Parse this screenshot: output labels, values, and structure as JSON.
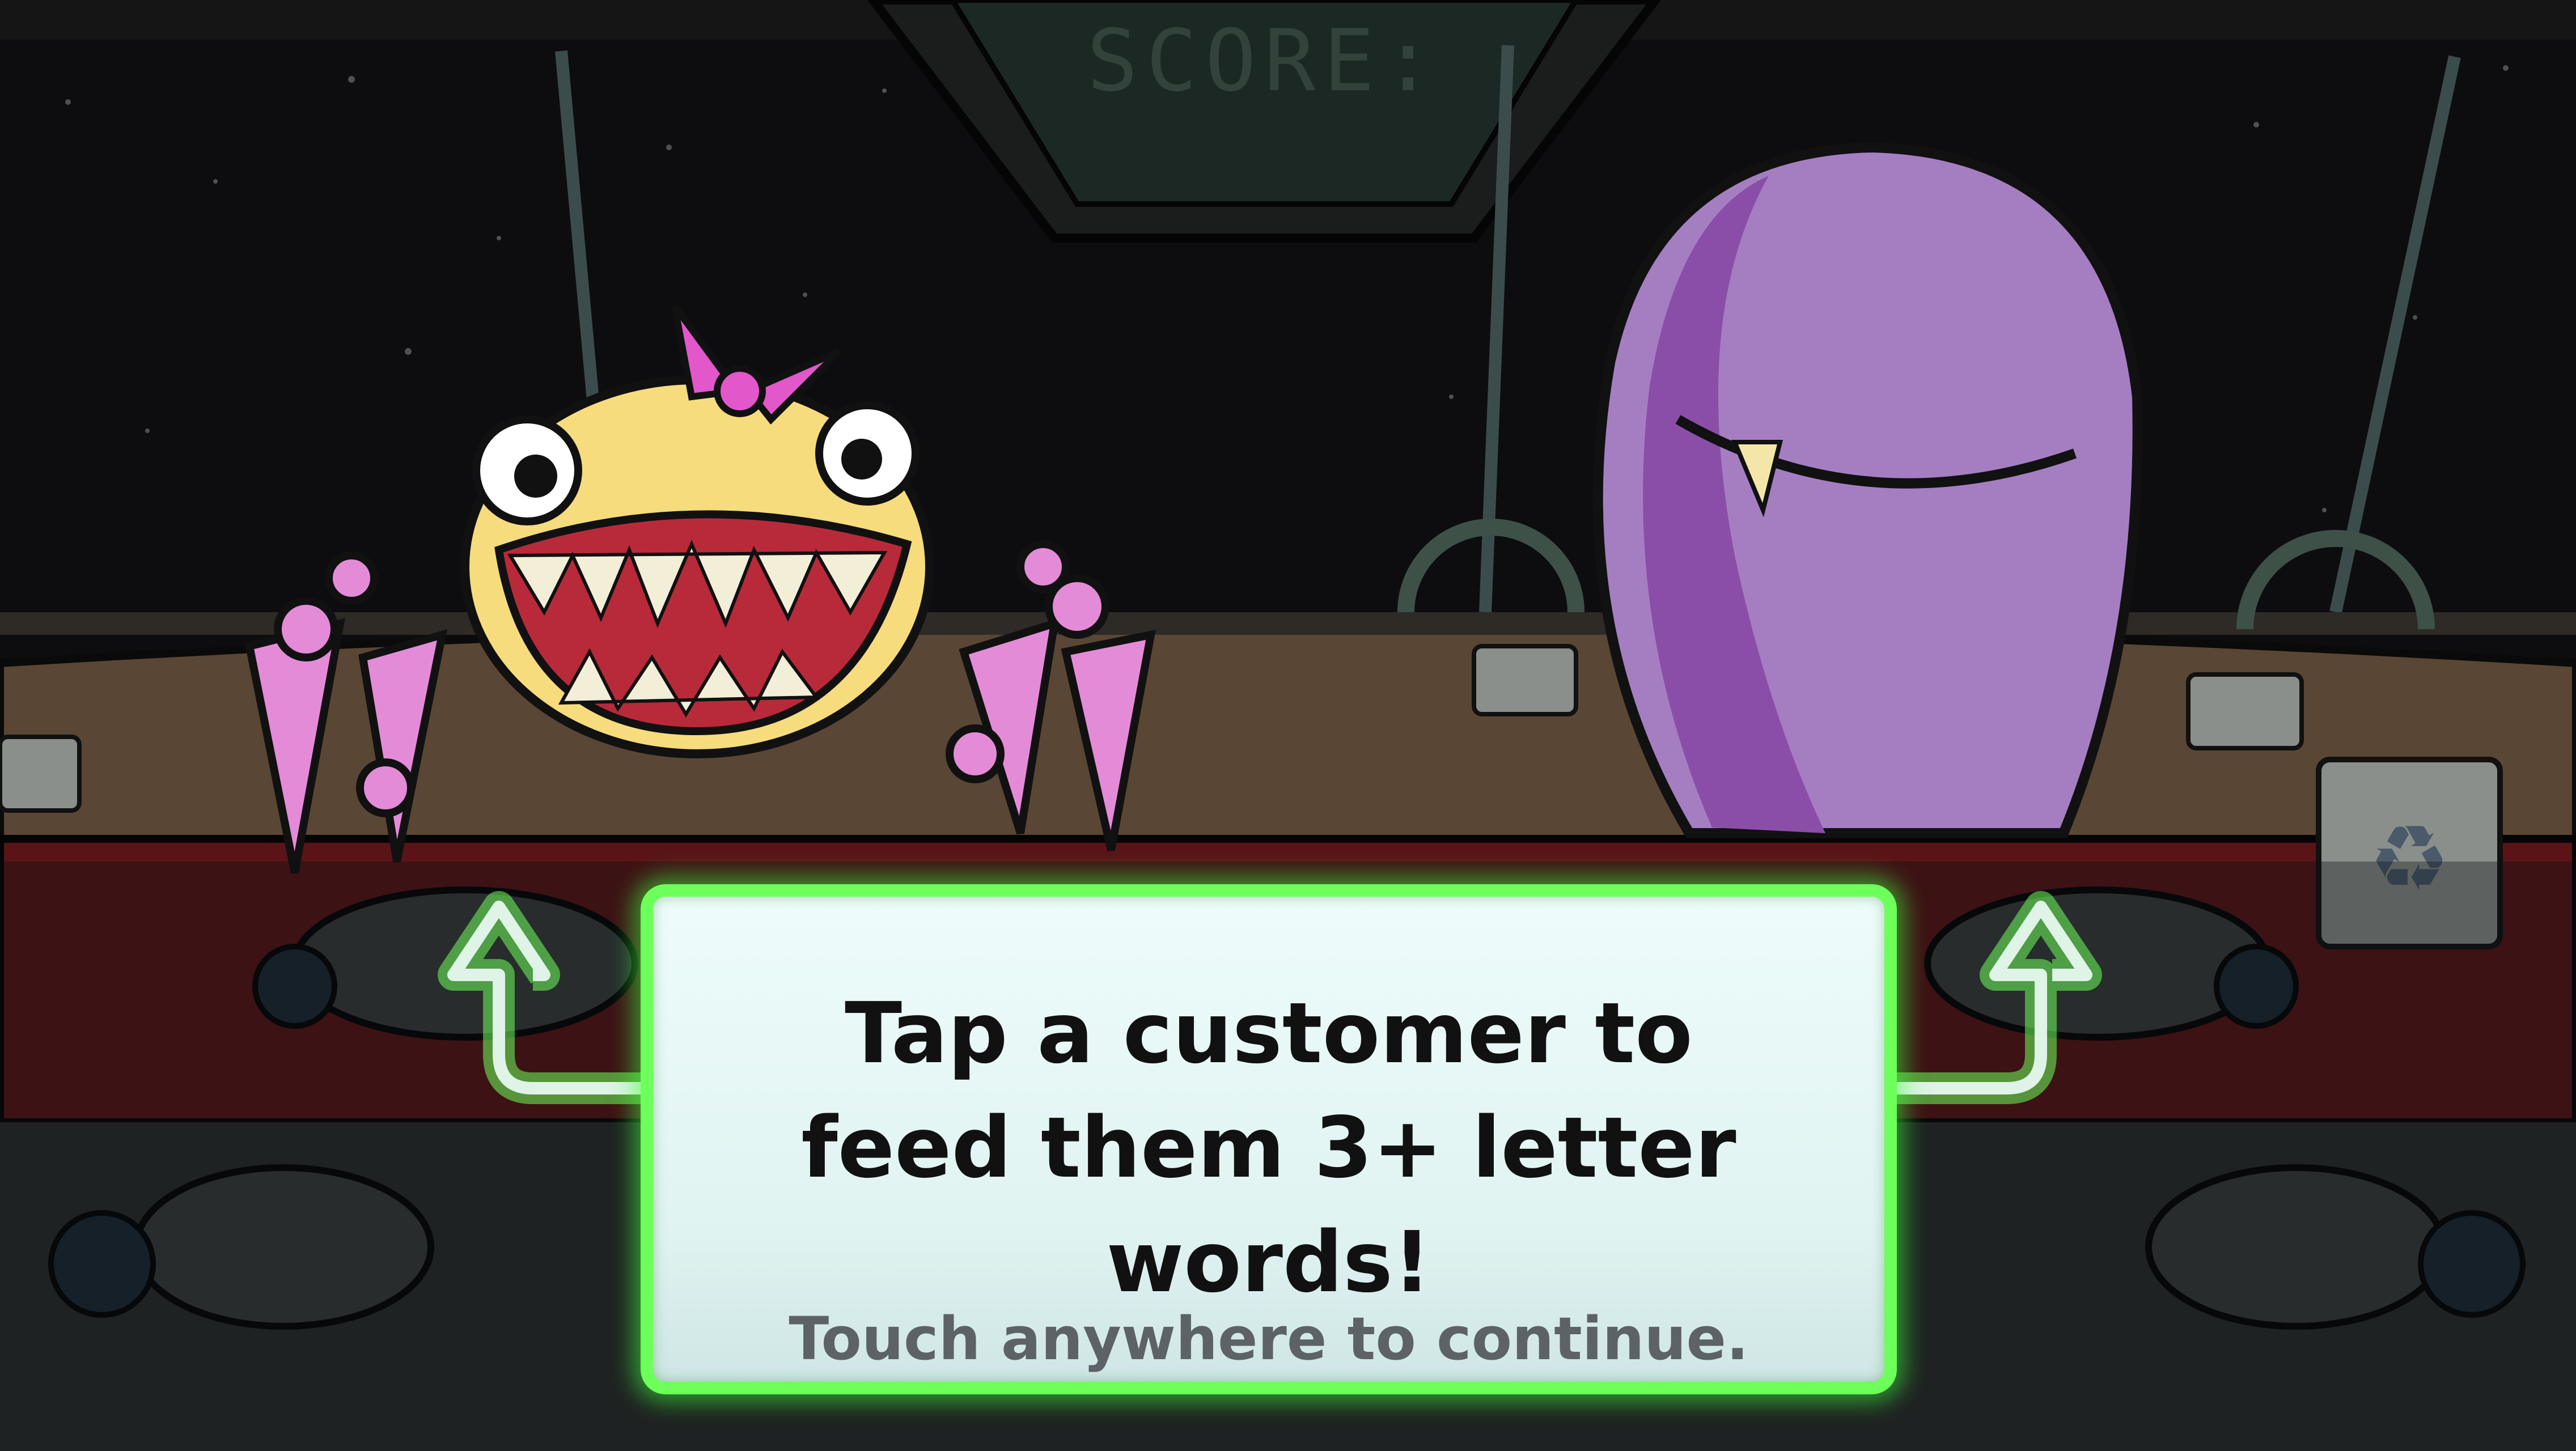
{
  "hud": {
    "score_label": "SCORE:"
  },
  "tutorial": {
    "line1": "Tap a customer to",
    "line2": "feed them 3+ letter words!",
    "hint": "Touch anywhere to continue."
  },
  "characters": [
    {
      "name": "spider-monster",
      "color": "#f6dc7c"
    },
    {
      "name": "purple-blob-monster",
      "color": "#a57ec2"
    }
  ],
  "colors": {
    "panel_border": "#6dff5a",
    "panel_fill": "#e6f8f6",
    "space": "#0c0c0e",
    "counter": "#5a4634",
    "conveyor": "#5a1418"
  },
  "icons": [
    "arrow-up-left-icon",
    "arrow-up-right-icon",
    "recycle-icon"
  ]
}
